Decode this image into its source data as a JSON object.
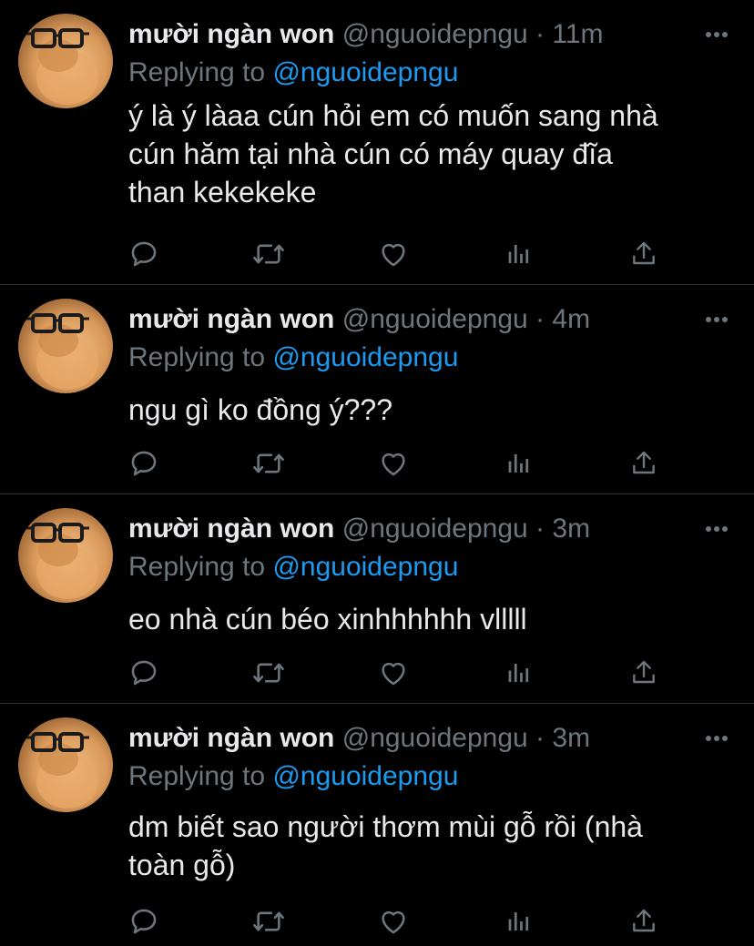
{
  "colors": {
    "background": "#000000",
    "text": "#e7e9ea",
    "muted": "#6e767d",
    "accent": "#1d9bf0",
    "divider": "#2f3336"
  },
  "tweets": [
    {
      "display_name": "mười ngàn won",
      "handle": "@nguoidepngu",
      "separator": "·",
      "time": "11m",
      "reply_prefix": "Replying to",
      "reply_target": "@nguoidepngu",
      "text": "ý là ý làaa cún hỏi em có muốn sang nhà\ncún hăm tại nhà cún có máy quay đĩa\nthan kekekeke",
      "icons": [
        "reply-icon",
        "retweet-icon",
        "like-icon",
        "analytics-icon",
        "share-icon"
      ]
    },
    {
      "display_name": "mười ngàn won",
      "handle": "@nguoidepngu",
      "separator": "·",
      "time": "4m",
      "reply_prefix": "Replying to",
      "reply_target": "@nguoidepngu",
      "text": "ngu gì ko đồng ý???",
      "icons": [
        "reply-icon",
        "retweet-icon",
        "like-icon",
        "analytics-icon",
        "share-icon"
      ]
    },
    {
      "display_name": "mười ngàn won",
      "handle": "@nguoidepngu",
      "separator": "·",
      "time": "3m",
      "reply_prefix": "Replying to",
      "reply_target": "@nguoidepngu",
      "text": "eo nhà cún béo xinhhhhhh vlllll",
      "icons": [
        "reply-icon",
        "retweet-icon",
        "like-icon",
        "analytics-icon",
        "share-icon"
      ]
    },
    {
      "display_name": "mười ngàn won",
      "handle": "@nguoidepngu",
      "separator": "·",
      "time": "3m",
      "reply_prefix": "Replying to",
      "reply_target": "@nguoidepngu",
      "text": "dm biết sao người thơm mùi gỗ rồi (nhà\ntoàn gỗ)",
      "icons": [
        "reply-icon",
        "retweet-icon",
        "like-icon",
        "analytics-icon",
        "share-icon"
      ]
    }
  ]
}
